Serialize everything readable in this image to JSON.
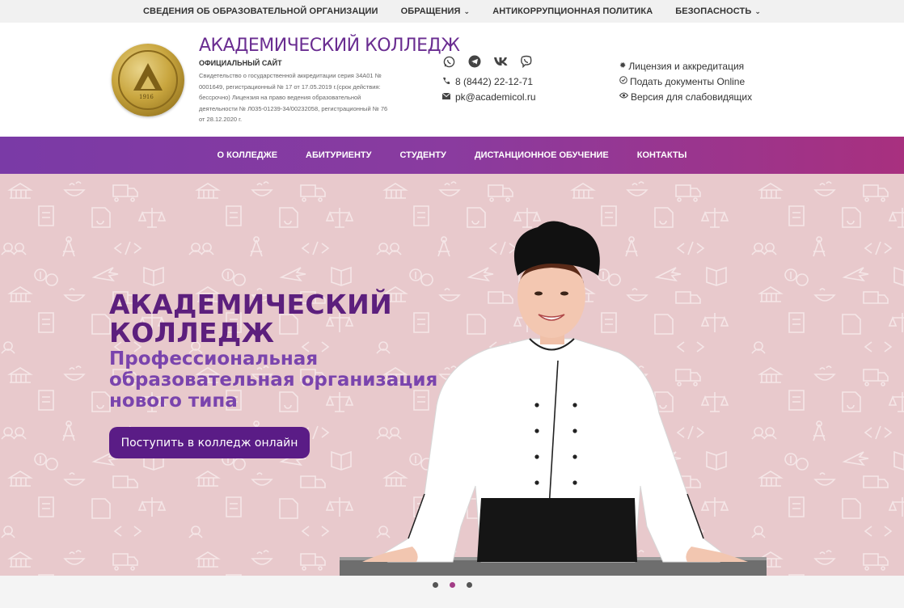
{
  "topbar": {
    "items": [
      {
        "label": "СВЕДЕНИЯ ОБ ОБРАЗОВАТЕЛЬНОЙ ОРГАНИЗАЦИИ",
        "dropdown": false
      },
      {
        "label": "ОБРАЩЕНИЯ",
        "dropdown": true
      },
      {
        "label": "АНТИКОРРУПЦИОННАЯ ПОЛИТИКА",
        "dropdown": false
      },
      {
        "label": "БЕЗОПАСНОСТЬ",
        "dropdown": true
      }
    ]
  },
  "header": {
    "logo_year": "1916",
    "title": "АКАДЕМИЧЕСКИЙ КОЛЛЕДЖ",
    "subtitle": "ОФИЦИАЛЬНЫЙ САЙТ",
    "description": "Свидетельство о государственной аккредитации серия 34А01 № 0001649, регистрационный № 17 от 17.05.2019 г.(срок действия: бессрочно) Лицензия на право ведения образовательной деятельности № Л035-01239-34/00232058, регистрационный № 76 от 28.12.2020 г.",
    "social_icons": [
      "whatsapp-icon",
      "telegram-icon",
      "vk-icon",
      "viber-icon"
    ],
    "phone": "8 (8442) 22-12-71",
    "email": "pk@academicol.ru",
    "links": [
      {
        "label": "Лицензия и аккредитация",
        "icon": "gear-icon"
      },
      {
        "label": "Подать документы Online",
        "icon": "check-circle-icon"
      },
      {
        "label": "Версия для слабовидящих",
        "icon": "eye-icon"
      }
    ]
  },
  "nav": {
    "items": [
      "О КОЛЛЕДЖЕ",
      "АБИТУРИЕНТУ",
      "СТУДЕНТУ",
      "ДИСТАНЦИОННОЕ ОБУЧЕНИЕ",
      "КОНТАКТЫ"
    ]
  },
  "hero": {
    "title_line1": "АКАДЕМИЧЕСКИЙ",
    "title_line2": "КОЛЛЕДЖ",
    "sub_line1": "Профессиональная",
    "sub_line2": "образовательная организация",
    "sub_line3": "нового типа",
    "button": "Поступить в колледж онлайн"
  },
  "carousel": {
    "count": 3,
    "active_index": 1
  },
  "colors": {
    "accent": "#6a2d91",
    "nav_start": "#7a3aa6",
    "nav_end": "#a8307f",
    "hero_bg": "#e8c9cc",
    "button_bg": "#5a1c86"
  }
}
